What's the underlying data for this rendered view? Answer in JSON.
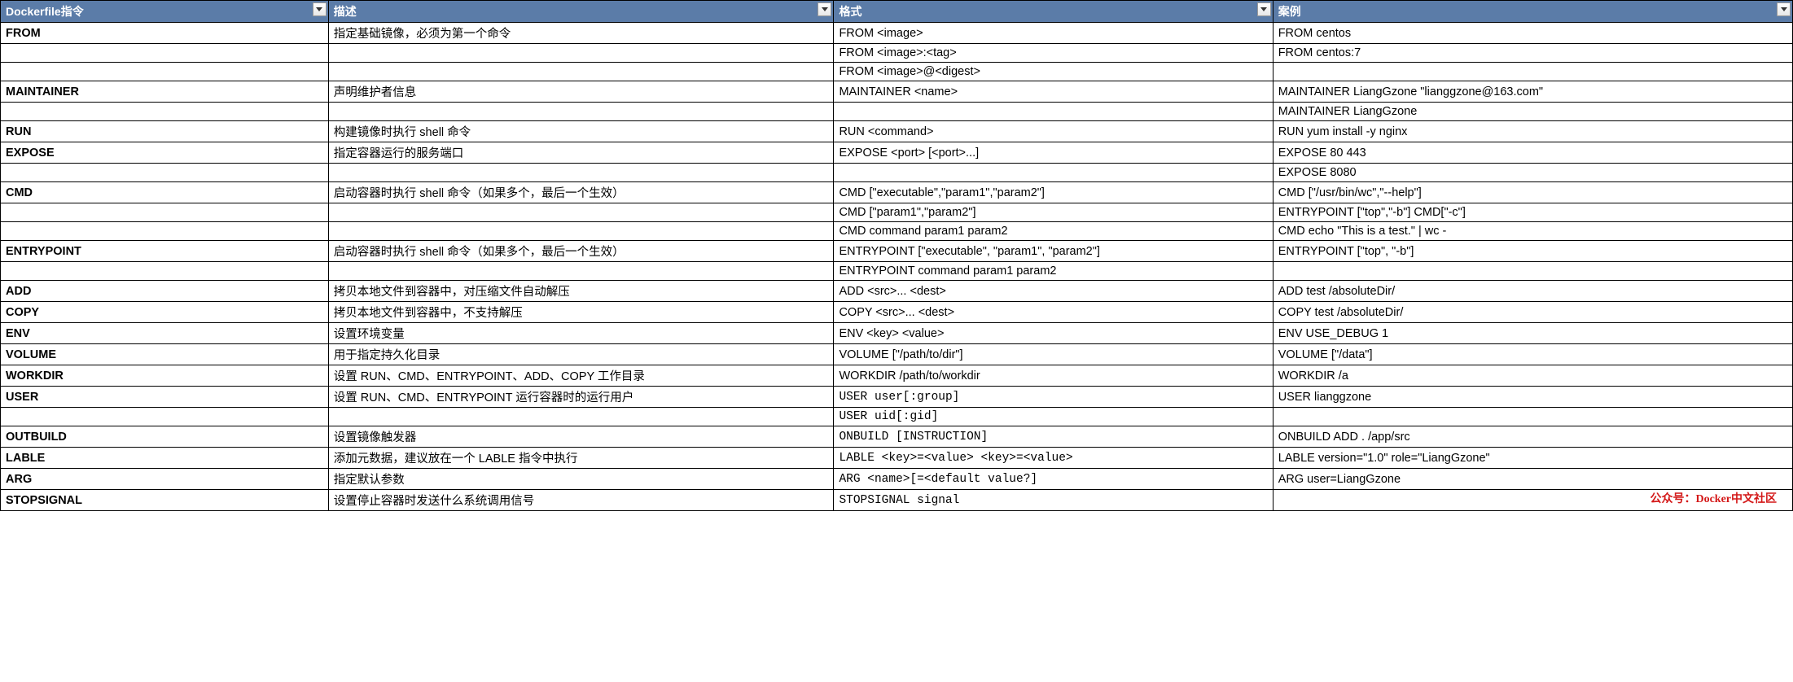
{
  "headers": [
    "Dockerfile指令",
    "描述",
    "格式",
    "案例"
  ],
  "rows": [
    {
      "cmd": "FROM",
      "desc": "指定基础镜像，必须为第一个命令",
      "fmt": "FROM <image>",
      "ex": "FROM centos"
    },
    {
      "cmd": "",
      "desc": "",
      "fmt": "FROM <image>:<tag>",
      "ex": "FROM centos:7"
    },
    {
      "cmd": "",
      "desc": "",
      "fmt": "FROM <image>@<digest>",
      "ex": ""
    },
    {
      "cmd": "MAINTAINER",
      "desc": "声明维护者信息",
      "fmt": "MAINTAINER <name>",
      "ex": "MAINTAINER LiangGzone \"lianggzone@163.com\""
    },
    {
      "cmd": "",
      "desc": "",
      "fmt": "",
      "ex": "MAINTAINER LiangGzone"
    },
    {
      "cmd": "RUN",
      "desc": "构建镜像时执行 shell 命令",
      "fmt": "RUN <command>",
      "ex": "RUN yum install -y nginx"
    },
    {
      "cmd": "EXPOSE",
      "desc": "指定容器运行的服务端口",
      "fmt": "EXPOSE <port> [<port>...]",
      "ex": "EXPOSE 80 443"
    },
    {
      "cmd": "",
      "desc": "",
      "fmt": "",
      "ex": "EXPOSE 8080"
    },
    {
      "cmd": "CMD",
      "desc": "启动容器时执行 shell 命令（如果多个，最后一个生效）",
      "fmt": "CMD [\"executable\",\"param1\",\"param2\"]",
      "ex": "CMD [\"/usr/bin/wc\",\"--help\"]"
    },
    {
      "cmd": "",
      "desc": "",
      "fmt": "CMD [\"param1\",\"param2\"]",
      "ex": "ENTRYPOINT [\"top\",\"-b\"] CMD[\"-c\"]"
    },
    {
      "cmd": "",
      "desc": "",
      "fmt": "CMD command param1 param2",
      "ex": "CMD echo \"This is a test.\" | wc -"
    },
    {
      "cmd": "ENTRYPOINT",
      "desc": "启动容器时执行 shell 命令（如果多个，最后一个生效）",
      "fmt": "ENTRYPOINT [\"executable\", \"param1\", \"param2\"]",
      "ex": "ENTRYPOINT [\"top\", \"-b\"]"
    },
    {
      "cmd": "",
      "desc": "",
      "fmt": "ENTRYPOINT command param1 param2",
      "ex": ""
    },
    {
      "cmd": "ADD",
      "desc": "拷贝本地文件到容器中，对压缩文件自动解压",
      "fmt": "ADD <src>... <dest>",
      "ex": "ADD test /absoluteDir/"
    },
    {
      "cmd": "COPY",
      "desc": "拷贝本地文件到容器中，不支持解压",
      "fmt": "COPY <src>... <dest>",
      "ex": "COPY test /absoluteDir/"
    },
    {
      "cmd": "ENV",
      "desc": "设置环境变量",
      "fmt": "ENV <key> <value>",
      "ex": "ENV USE_DEBUG 1"
    },
    {
      "cmd": "VOLUME",
      "desc": "用于指定持久化目录",
      "fmt": "VOLUME [\"/path/to/dir\"]",
      "ex": "VOLUME [\"/data\"]"
    },
    {
      "cmd": "WORKDIR",
      "desc": "设置 RUN、CMD、ENTRYPOINT、ADD、COPY 工作目录",
      "fmt": "WORKDIR /path/to/workdir",
      "ex": "WORKDIR /a"
    },
    {
      "cmd": "USER",
      "desc": "设置 RUN、CMD、ENTRYPOINT 运行容器时的运行用户",
      "fmt": "USER user[:group]",
      "ex": "USER lianggzone",
      "mono": true
    },
    {
      "cmd": "",
      "desc": "",
      "fmt": "USER uid[:gid]",
      "ex": "",
      "mono": true
    },
    {
      "cmd": "OUTBUILD",
      "desc": "设置镜像触发器",
      "fmt": "ONBUILD [INSTRUCTION]",
      "ex": "ONBUILD ADD . /app/src",
      "mono": true
    },
    {
      "cmd": "LABLE",
      "desc": "添加元数据，建议放在一个 LABLE 指令中执行",
      "fmt": "LABLE <key>=<value>  <key>=<value>",
      "ex": "LABLE version=\"1.0\" role=\"LiangGzone\"",
      "mono": true
    },
    {
      "cmd": "ARG",
      "desc": "指定默认参数",
      "fmt": "ARG <name>[=<default value?]",
      "ex": "ARG user=LiangGzone",
      "mono": true
    },
    {
      "cmd": "STOPSIGNAL",
      "desc": "设置停止容器时发送什么系统调用信号",
      "fmt": "STOPSIGNAL signal",
      "ex": "",
      "mono": true
    }
  ],
  "watermark": "公众号：Docker中文社区"
}
